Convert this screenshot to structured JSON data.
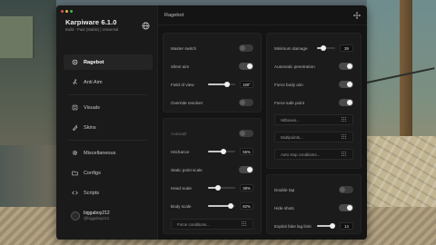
{
  "app": {
    "title": "Karpiware 6.1.0",
    "subtitle": "Build - Paid (Stable) | Universal",
    "dots": [
      "#e5534b",
      "#e6b43c",
      "#3fb653"
    ]
  },
  "sidebar": {
    "items": [
      {
        "label": "Ragebot",
        "icon": "crosshair-icon",
        "active": true
      },
      {
        "label": "Anti Aim",
        "icon": "running-figure-icon",
        "active": false
      },
      {
        "label": "Visuals",
        "icon": "visuals-icon",
        "active": false
      },
      {
        "label": "Skins",
        "icon": "skins-icon",
        "active": false
      },
      {
        "label": "Miscellaneous",
        "icon": "gear-icon",
        "active": false
      },
      {
        "label": "Configs",
        "icon": "folder-icon",
        "active": false
      },
      {
        "label": "Scripts",
        "icon": "code-icon",
        "active": false
      }
    ],
    "user": {
      "name": "biggaboy212",
      "handle": "@biggaboy212"
    }
  },
  "header": {
    "title": "Ragebot"
  },
  "panels": {
    "main_left": {
      "rows": [
        {
          "label": "Master switch",
          "type": "toggle",
          "on": false
        },
        {
          "label": "Silent aim",
          "type": "toggle",
          "on": true
        },
        {
          "label": "Field of view",
          "type": "slider",
          "fraction": 0.7,
          "value": "180°"
        },
        {
          "label": "Override resolver",
          "type": "toggle",
          "on": false
        }
      ]
    },
    "main_right": {
      "rows": [
        {
          "label": "Minimum damage",
          "type": "slider",
          "fraction": 0.35,
          "value": "39"
        },
        {
          "label": "Automatic penetration",
          "type": "toggle",
          "on": true
        },
        {
          "label": "Force body aim",
          "type": "toggle",
          "on": true
        },
        {
          "label": "Force safe point",
          "type": "toggle",
          "on": true
        }
      ],
      "dropdowns": [
        "Hitboxes...",
        "Multipoints...",
        "Auto stop conditions..."
      ]
    },
    "accuracy": {
      "rows": [
        {
          "label": "Autowall",
          "type": "toggle",
          "on": false,
          "dim": true
        },
        {
          "label": "Hitchance",
          "type": "slider",
          "fraction": 0.55,
          "value": "55%"
        },
        {
          "label": "Static point scale",
          "type": "toggle",
          "on": true
        },
        {
          "label": "Head scale",
          "type": "slider",
          "fraction": 0.38,
          "value": "38%"
        },
        {
          "label": "Body scale",
          "type": "slider",
          "fraction": 0.82,
          "value": "82%"
        }
      ],
      "dropdowns": [
        "Force conditions..."
      ]
    },
    "exploits": {
      "rows": [
        {
          "label": "Double tap",
          "type": "toggle",
          "on": false
        },
        {
          "label": "Hide shots",
          "type": "toggle",
          "on": true
        },
        {
          "label": "Exploit fake lag limit",
          "type": "slider",
          "fraction": 0.85,
          "value": "14"
        }
      ]
    }
  }
}
